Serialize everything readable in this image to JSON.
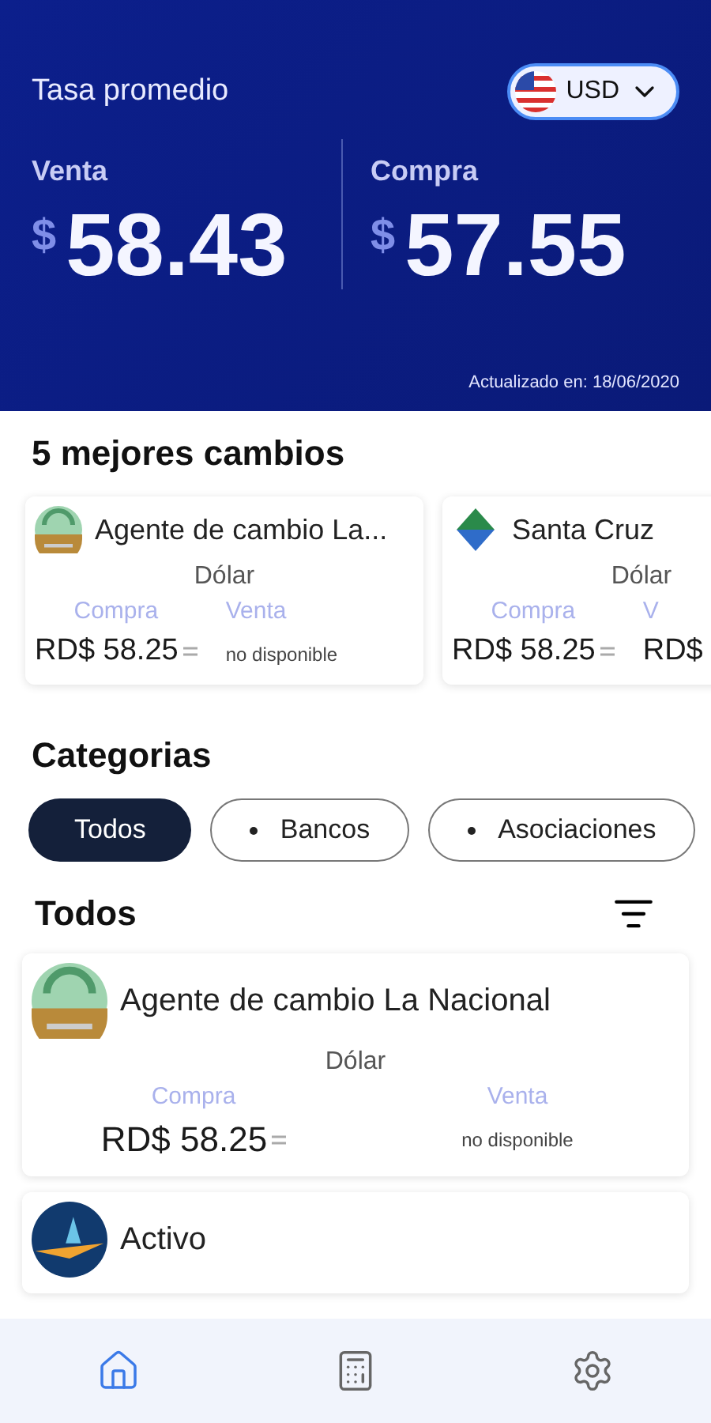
{
  "header": {
    "title": "Tasa promedio",
    "currency": {
      "code": "USD"
    },
    "rates": [
      {
        "label": "Venta",
        "symbol": "$",
        "value": "58.43"
      },
      {
        "label": "Compra",
        "symbol": "$",
        "value": "57.55"
      }
    ],
    "updated": "Actualizado en: 18/06/2020"
  },
  "best": {
    "title": "5 mejores cambios",
    "cards": [
      {
        "name": "Agente de cambio La...",
        "kind": "wreath",
        "currency": "Dólar",
        "buy_label": "Compra",
        "sell_label": "Venta",
        "buy": {
          "kind": "price",
          "text": "RD$ 58.25"
        },
        "sell": {
          "kind": "unavailable",
          "text": "no disponible"
        }
      },
      {
        "name": "Santa Cruz",
        "kind": "diamond",
        "currency": "Dólar",
        "buy_label": "Compra",
        "sell_label": "V",
        "buy": {
          "kind": "price",
          "text": "RD$ 58.25"
        },
        "sell": {
          "kind": "cut",
          "text": "RD$"
        }
      }
    ]
  },
  "categories": {
    "title": "Categorias",
    "chips": [
      {
        "label": "Todos",
        "selected": true
      },
      {
        "label": "Bancos",
        "selected": false
      },
      {
        "label": "Asociaciones",
        "selected": false
      }
    ]
  },
  "list": {
    "title": "Todos",
    "items": [
      {
        "name": "Agente de cambio La Nacional",
        "kind": "wreath",
        "currency": "Dólar",
        "buy_label": "Compra",
        "sell_label": "Venta",
        "buy": {
          "kind": "price",
          "text": "RD$ 58.25"
        },
        "sell": {
          "kind": "unavailable",
          "text": "no disponible"
        }
      },
      {
        "name": "Activo",
        "kind": "bird"
      }
    ]
  },
  "nav": [
    {
      "kind": "home",
      "selected": true
    },
    {
      "kind": "calculator",
      "selected": false
    },
    {
      "kind": "settings",
      "selected": false
    }
  ]
}
